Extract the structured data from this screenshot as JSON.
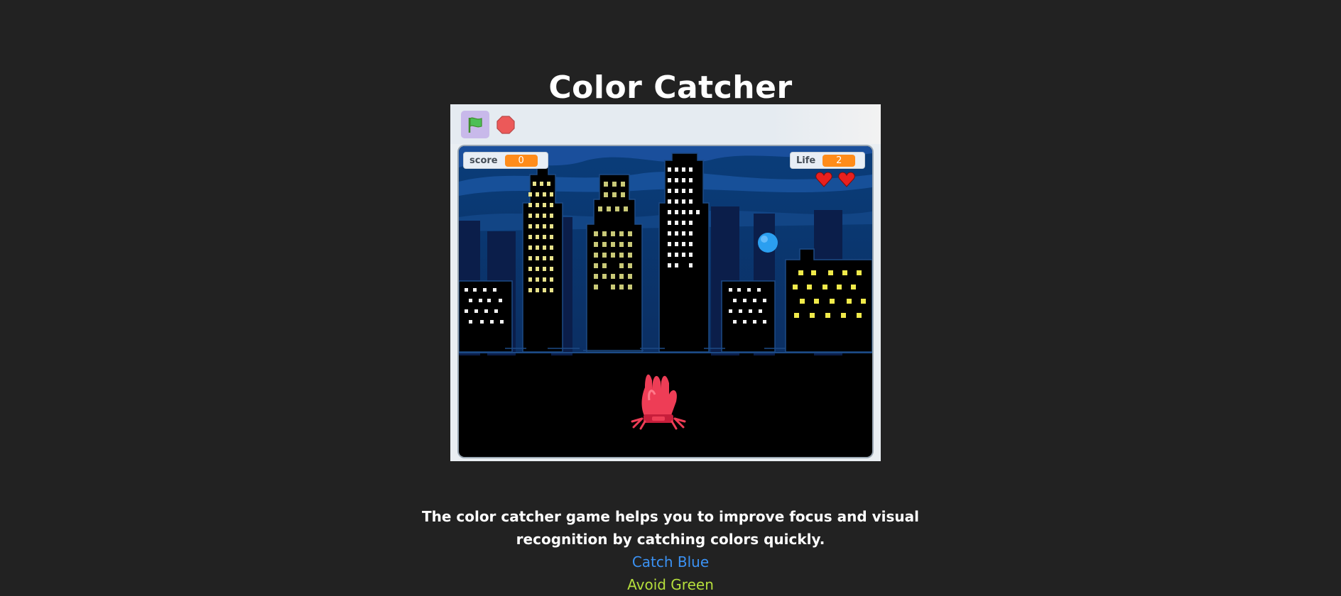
{
  "page": {
    "title": "Color Catcher"
  },
  "controls": {
    "green_flag_icon": "green-flag-icon",
    "stop_icon": "stop-sign-icon"
  },
  "game": {
    "score_label": "score",
    "score_value": "0",
    "life_label": "Life",
    "life_value": "2",
    "hearts_shown": 2,
    "falling_ball_color": "#2b9ff0",
    "catcher_color": "#f2404f"
  },
  "description": {
    "line1": "The color catcher game helps you to improve  focus and visual",
    "line2": "recognition by catching colors quickly.",
    "catch_text": "Catch Blue",
    "avoid_text": "Avoid Green"
  },
  "colors": {
    "background": "#222222",
    "catch_color": "#3b92f4",
    "avoid_color": "#b5de3c",
    "monitor_value": "#ff8c1a",
    "heart": "#e8201e"
  }
}
